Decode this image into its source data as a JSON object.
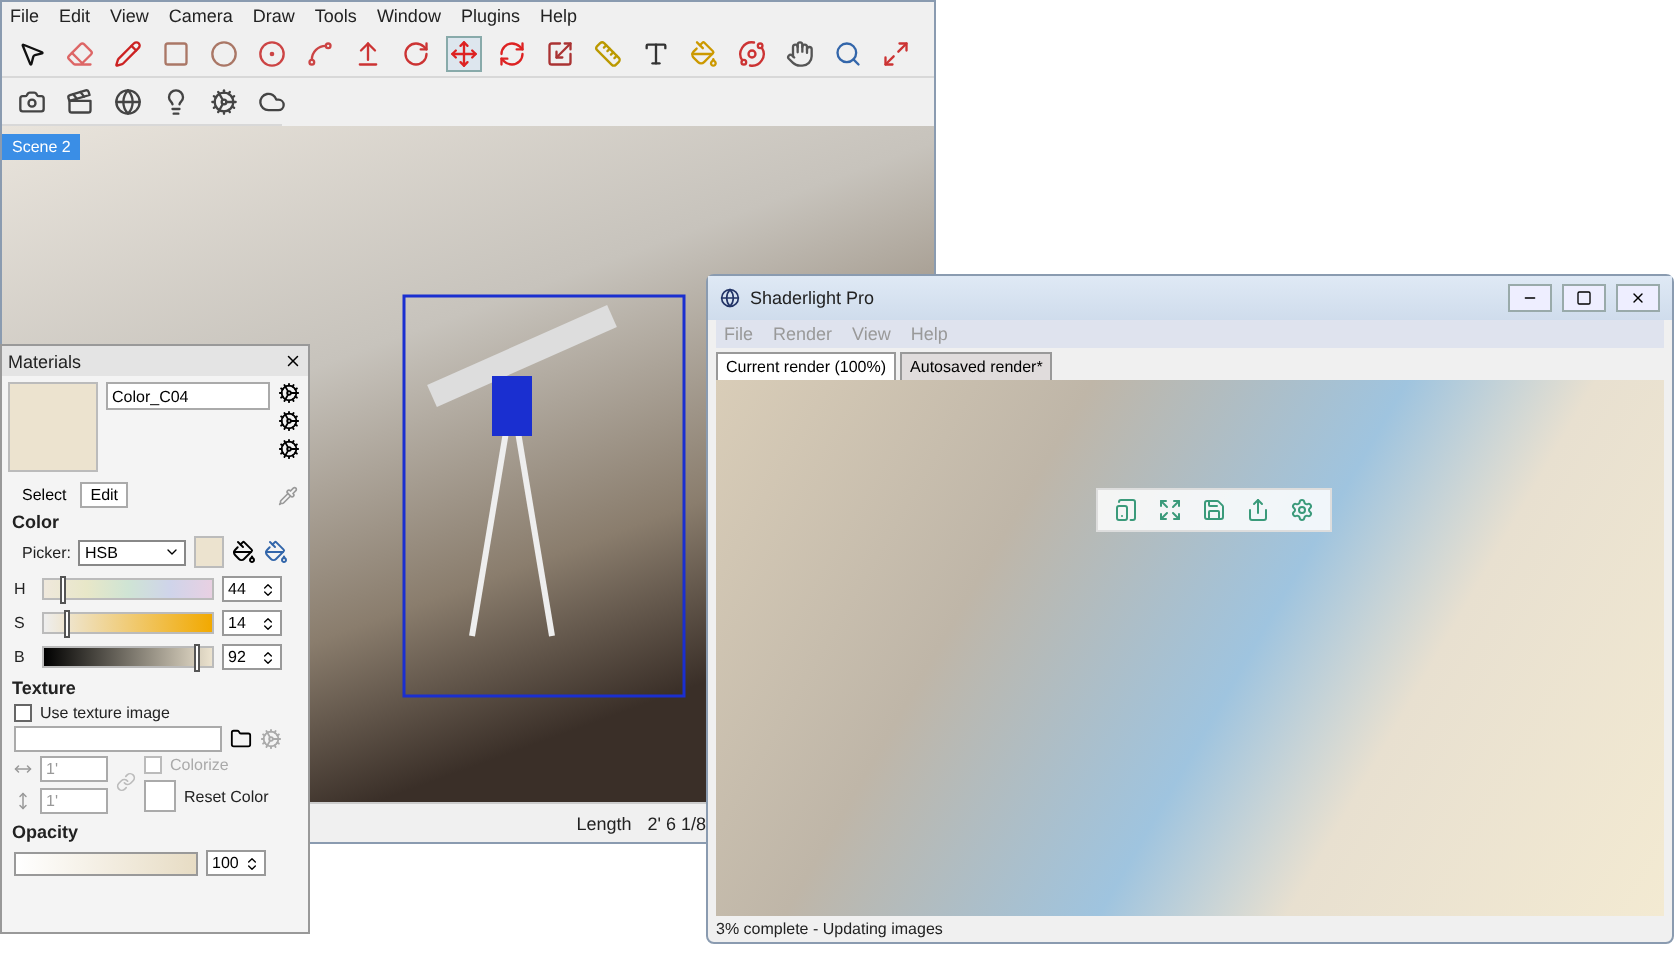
{
  "sketchup": {
    "menu": [
      "File",
      "Edit",
      "View",
      "Camera",
      "Draw",
      "Tools",
      "Window",
      "Plugins",
      "Help"
    ],
    "scene_tabs": [
      {
        "label": "Scene 2",
        "selected": true
      }
    ],
    "status": {
      "label": "Length",
      "value": "2' 6 1/8"
    }
  },
  "materials": {
    "title": "Materials",
    "material_name": "Color_C04",
    "tabs": [
      {
        "label": "Select",
        "selected": false
      },
      {
        "label": "Edit",
        "selected": true
      }
    ],
    "color_heading": "Color",
    "picker_label": "Picker:",
    "picker_value": "HSB",
    "sliders": [
      {
        "label": "H",
        "kind": "hue",
        "level": 0.12,
        "value": "44"
      },
      {
        "label": "S",
        "kind": "saturation",
        "level": 0.14,
        "value": "14"
      },
      {
        "label": "B",
        "kind": "brightness",
        "level": 0.92,
        "value": "92"
      }
    ],
    "texture_heading": "Texture",
    "use_texture": {
      "label": "Use texture image",
      "checked": false
    },
    "texture_width": "1'",
    "texture_height": "1'",
    "colorize": {
      "label": "Colorize",
      "checked": false,
      "disabled": true
    },
    "reset_label": "Reset Color",
    "opacity_heading": "Opacity",
    "opacity": {
      "level": 1,
      "value": "100"
    }
  },
  "shaderlight": {
    "title": "Shaderlight Pro",
    "menu": [
      "File",
      "Render",
      "View",
      "Help"
    ],
    "tabs": [
      {
        "label": "Current render (100%)",
        "selected": true
      },
      {
        "label": "Autosaved render*",
        "selected": false
      }
    ],
    "status": "3% complete - Updating images"
  }
}
